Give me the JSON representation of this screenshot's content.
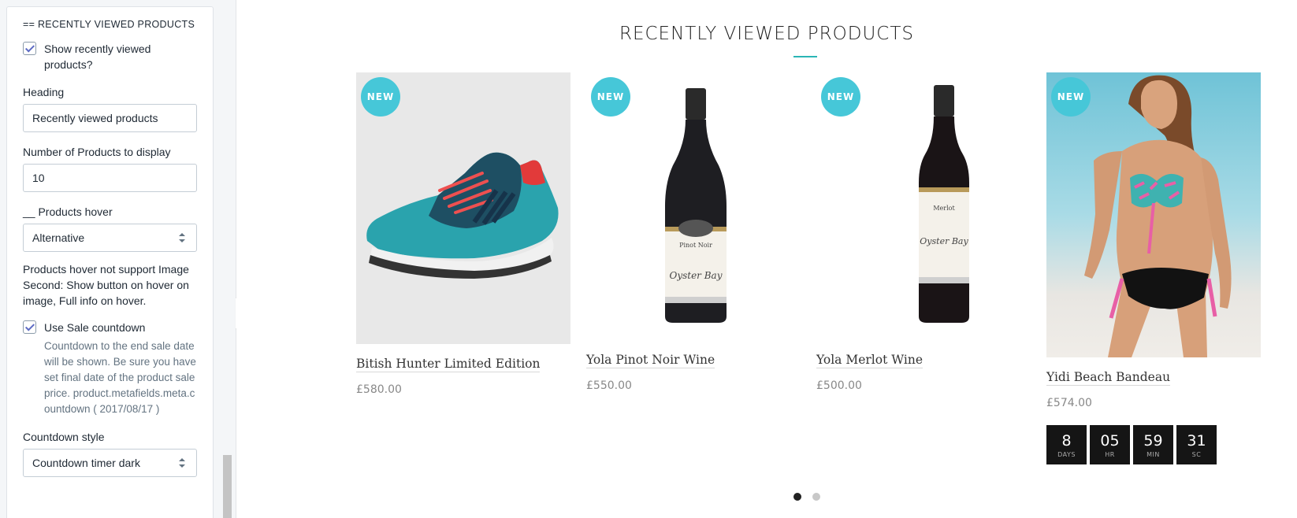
{
  "sidebar": {
    "section_title": "== RECENTLY VIEWED PRODUCTS",
    "show_recently_viewed": {
      "label": "Show recently viewed products?",
      "checked": true
    },
    "heading": {
      "label": "Heading",
      "value": "Recently viewed products"
    },
    "num_products": {
      "label": "Number of Products to display",
      "value": "10"
    },
    "products_hover": {
      "label": "__ Products hover",
      "value": "Alternative"
    },
    "hover_help": "Products hover not support Image Second: Show button on hover on image, Full info on hover.",
    "sale_countdown": {
      "label": "Use Sale countdown",
      "checked": true,
      "info": "Countdown to the end sale date will be shown. Be sure you have set final date of the product sale price. product.metafields.meta.countdown ( 2017/08/17 )"
    },
    "countdown_style": {
      "label": "Countdown style",
      "value": "Countdown timer dark"
    }
  },
  "main": {
    "heading": "RECENTLY VIEWED PRODUCTS",
    "accent_color": "#2ab5b5",
    "badge_color": "#46c7d8",
    "products": [
      {
        "badge": "NEW",
        "title": "Bitish Hunter Limited Edition",
        "price": "£580.00",
        "image": "sneaker-image"
      },
      {
        "badge": "NEW",
        "title": "Yola Pinot Noir Wine",
        "price": "£550.00",
        "image": "wine-bottle-image"
      },
      {
        "badge": "NEW",
        "title": "Yola Merlot Wine",
        "price": "£500.00",
        "image": "wine-bottle-image"
      },
      {
        "badge": "NEW",
        "title": "Yidi Beach Bandeau",
        "price": "£574.00",
        "image": "beach-model-image",
        "countdown": [
          {
            "value": "8",
            "unit": "DAYS"
          },
          {
            "value": "05",
            "unit": "HR"
          },
          {
            "value": "59",
            "unit": "MIN"
          },
          {
            "value": "31",
            "unit": "SC"
          }
        ]
      }
    ],
    "pagination": {
      "pages": 2,
      "current": 1
    }
  }
}
